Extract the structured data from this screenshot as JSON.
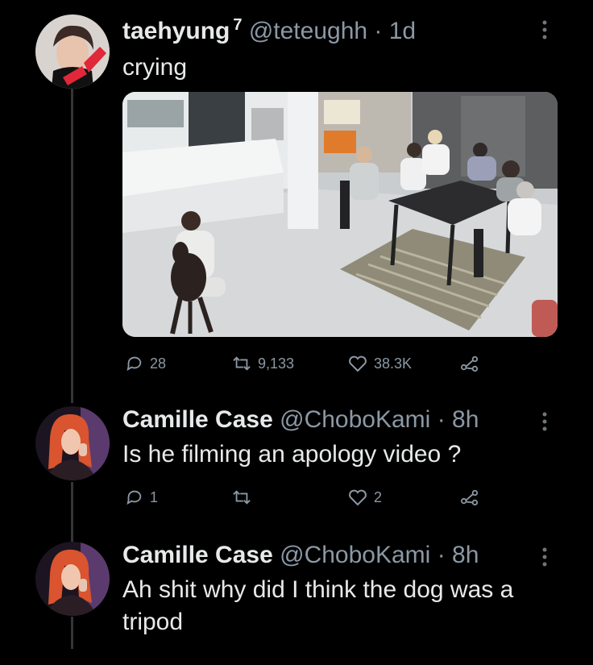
{
  "tweets": [
    {
      "name": "taehyung",
      "badge": "7",
      "handle": "@teteughh",
      "time": "· 1d",
      "text": "crying",
      "avatar_icon": "profile-photo",
      "actions": {
        "replies": "28",
        "retweets": "9,133",
        "likes": "38.3K"
      }
    },
    {
      "name": "Camille Case",
      "handle": "@ChoboKami",
      "time": "· 8h",
      "text": "Is he filming an apology video ?",
      "avatar_icon": "profile-photo",
      "actions": {
        "replies": "1",
        "retweets": "",
        "likes": "2"
      }
    },
    {
      "name": "Camille Case",
      "handle": "@ChoboKami",
      "time": "· 8h",
      "text": "Ah shit why did I think the dog was a tripod"
    }
  ],
  "icons": {
    "reply": "reply-icon",
    "retweet": "retweet-icon",
    "like": "heart-icon",
    "share": "share-icon",
    "more": "more-vertical-icon"
  },
  "colors": {
    "background": "#000000",
    "text": "#e7e9ea",
    "muted": "#8b98a5"
  }
}
